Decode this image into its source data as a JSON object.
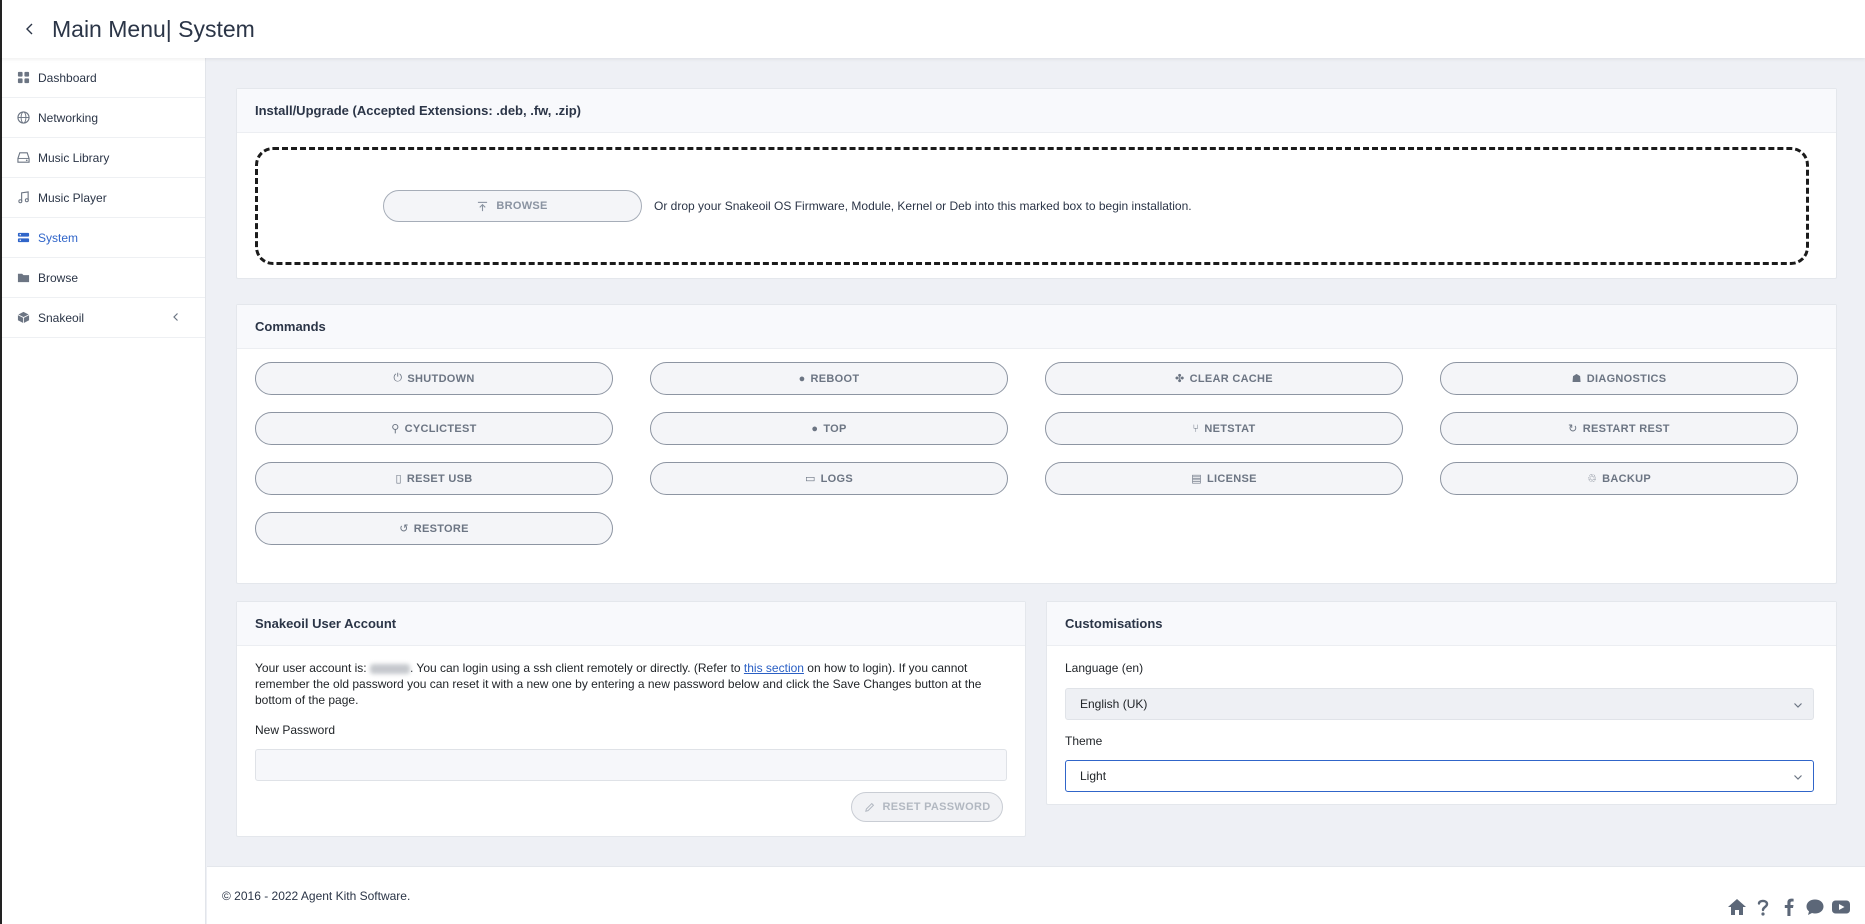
{
  "header": {
    "title": "Main Menu| System",
    "back_icon": "chevron-left-icon"
  },
  "sidebar": {
    "items": [
      {
        "label": "Dashboard",
        "icon": "grid-icon"
      },
      {
        "label": "Networking",
        "icon": "globe-icon"
      },
      {
        "label": "Music Library",
        "icon": "hdd-icon"
      },
      {
        "label": "Music Player",
        "icon": "music-note-icon"
      },
      {
        "label": "System",
        "icon": "server-icon",
        "active": true
      },
      {
        "label": "Browse",
        "icon": "folder-icon"
      },
      {
        "label": "Snakeoil",
        "icon": "cube-icon"
      }
    ]
  },
  "install": {
    "title": "Install/Upgrade (Accepted Extensions: .deb, .fw, .zip)",
    "browse_label": "BROWSE",
    "drop_text": "Or drop your Snakeoil OS Firmware, Module, Kernel or Deb into this marked box to begin installation."
  },
  "commands": {
    "title": "Commands",
    "buttons": [
      {
        "label": "SHUTDOWN",
        "glyph": "⏻",
        "icon": "power-icon"
      },
      {
        "label": "REBOOT",
        "glyph": "●",
        "icon": "reboot-icon"
      },
      {
        "label": "CLEAR CACHE",
        "glyph": "✤",
        "icon": "cache-icon"
      },
      {
        "label": "DIAGNOSTICS",
        "glyph": "☗",
        "icon": "user-doctor-icon"
      },
      {
        "label": "CYCLICTEST",
        "glyph": "⚲",
        "icon": "bike-icon"
      },
      {
        "label": "TOP",
        "glyph": "●",
        "icon": "circle-icon"
      },
      {
        "label": "NETSTAT",
        "glyph": "⑂",
        "icon": "fork-icon"
      },
      {
        "label": "RESTART REST",
        "glyph": "↻",
        "icon": "refresh-icon"
      },
      {
        "label": "RESET USB",
        "glyph": "▯",
        "icon": "usb-icon"
      },
      {
        "label": "LOGS",
        "glyph": "▭",
        "icon": "monitor-icon"
      },
      {
        "label": "LICENSE",
        "glyph": "▤",
        "icon": "file-icon"
      },
      {
        "label": "BACKUP",
        "glyph": "♲",
        "icon": "recycle-icon"
      },
      {
        "label": "RESTORE",
        "glyph": "↺",
        "icon": "history-icon"
      }
    ]
  },
  "account": {
    "title": "Snakeoil User Account",
    "text_before": "Your user account is: ",
    "text_after_user": ". You can login using a ssh client remotely or directly. (Refer to ",
    "link": "this section",
    "text_after_link": " on how to login). If you cannot remember the old password you can reset it with a new one by entering a new password below and click the Save Changes button at the bottom of the page.",
    "password_label": "New Password",
    "password_value": "",
    "reset_label": "RESET PASSWORD"
  },
  "customisations": {
    "title": "Customisations",
    "language_label": "Language  (en)",
    "language_value": "English (UK)",
    "theme_label": "Theme",
    "theme_value": "Light"
  },
  "footer": {
    "copyright": "© 2016 - 2022 Agent Kith Software.",
    "social_icons": [
      "home-icon",
      "question-icon",
      "facebook-icon",
      "chat-icon",
      "youtube-icon"
    ]
  },
  "colors": {
    "accent": "#3065c9",
    "text": "#2b3547",
    "background": "#eef0f5"
  }
}
